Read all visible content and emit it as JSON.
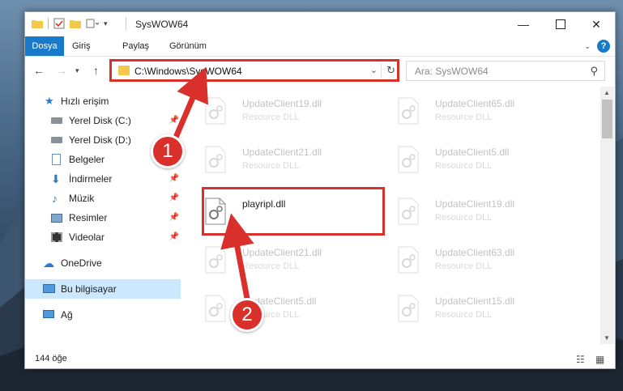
{
  "window": {
    "title": "SysWOW64"
  },
  "ribbon": {
    "tabs": [
      "Dosya",
      "Giriş",
      "Paylaş",
      "Görünüm"
    ],
    "help_label": "?"
  },
  "address": {
    "path": "C:\\Windows\\SysWOW64",
    "search_placeholder": "Ara: SysWOW64"
  },
  "nav": {
    "items": [
      {
        "label": "Hızlı erişim",
        "icon": "star-icon"
      },
      {
        "label": "Yerel Disk (C:)",
        "icon": "drive-icon"
      },
      {
        "label": "Yerel Disk (D:)",
        "icon": "drive-icon"
      },
      {
        "label": "Belgeler",
        "icon": "documents-icon"
      },
      {
        "label": "İndirmeler",
        "icon": "download-icon"
      },
      {
        "label": "Müzik",
        "icon": "music-icon"
      },
      {
        "label": "Resimler",
        "icon": "pictures-icon"
      },
      {
        "label": "Videolar",
        "icon": "videos-icon"
      },
      {
        "label": "OneDrive",
        "icon": "cloud-icon"
      },
      {
        "label": "Bu bilgisayar",
        "icon": "computer-icon"
      },
      {
        "label": "Ağ",
        "icon": "network-icon"
      }
    ]
  },
  "files": {
    "left": [
      {
        "name": "UpdateClient19.dll",
        "desc": "Resource DLL"
      },
      {
        "name": "UpdateClient21.dll",
        "desc": "Resource DLL"
      },
      {
        "name": "playripl.dll",
        "desc": ""
      },
      {
        "name": "UpdateClient21.dll",
        "desc": "Resource DLL"
      },
      {
        "name": "UpdateClient5.dll",
        "desc": "Resource DLL"
      }
    ],
    "right": [
      {
        "name": "UpdateClient65.dll",
        "desc": "Resource DLL"
      },
      {
        "name": "UpdateClient5.dll",
        "desc": "Resource DLL"
      },
      {
        "name": "UpdateClient19.dll",
        "desc": "Resource DLL"
      },
      {
        "name": "UpdateClient63.dll",
        "desc": "Resource DLL"
      },
      {
        "name": "UpdateClient15.dll",
        "desc": "Resource DLL"
      }
    ]
  },
  "status": {
    "count": "144 öğe"
  },
  "callouts": {
    "one": "1",
    "two": "2"
  },
  "colors": {
    "accent": "#1979ca",
    "highlight": "#d9302c",
    "selected": "#cce8ff"
  }
}
